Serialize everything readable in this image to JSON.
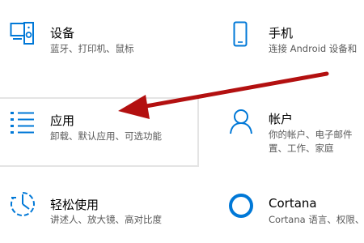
{
  "tiles": {
    "devices": {
      "title": "设备",
      "subtitle": "蓝牙、打印机、鼠标"
    },
    "phone": {
      "title": "手机",
      "subtitle": "连接 Android 设备和"
    },
    "apps": {
      "title": "应用",
      "subtitle": "卸载、默认应用、可选功能"
    },
    "accounts": {
      "title": "帐户",
      "subtitle_line1": "你的帐户、电子邮件",
      "subtitle_line2": "置、工作、家庭"
    },
    "ease": {
      "title": "轻松使用",
      "subtitle": "讲述人、放大镜、高对比度"
    },
    "cortana": {
      "title": "Cortana",
      "subtitle": "Cortana 语言、权限、"
    }
  },
  "colors": {
    "accent": "#0078d7",
    "annotation_arrow": "#b31010",
    "subtitle_text": "#5a5a5a",
    "selected_border": "#e4e4e4"
  },
  "icons": {
    "devices": "devices-icon",
    "phone": "phone-icon",
    "apps": "apps-list-icon",
    "accounts": "person-icon",
    "ease": "ease-of-access-icon",
    "cortana": "cortana-ring-icon"
  }
}
